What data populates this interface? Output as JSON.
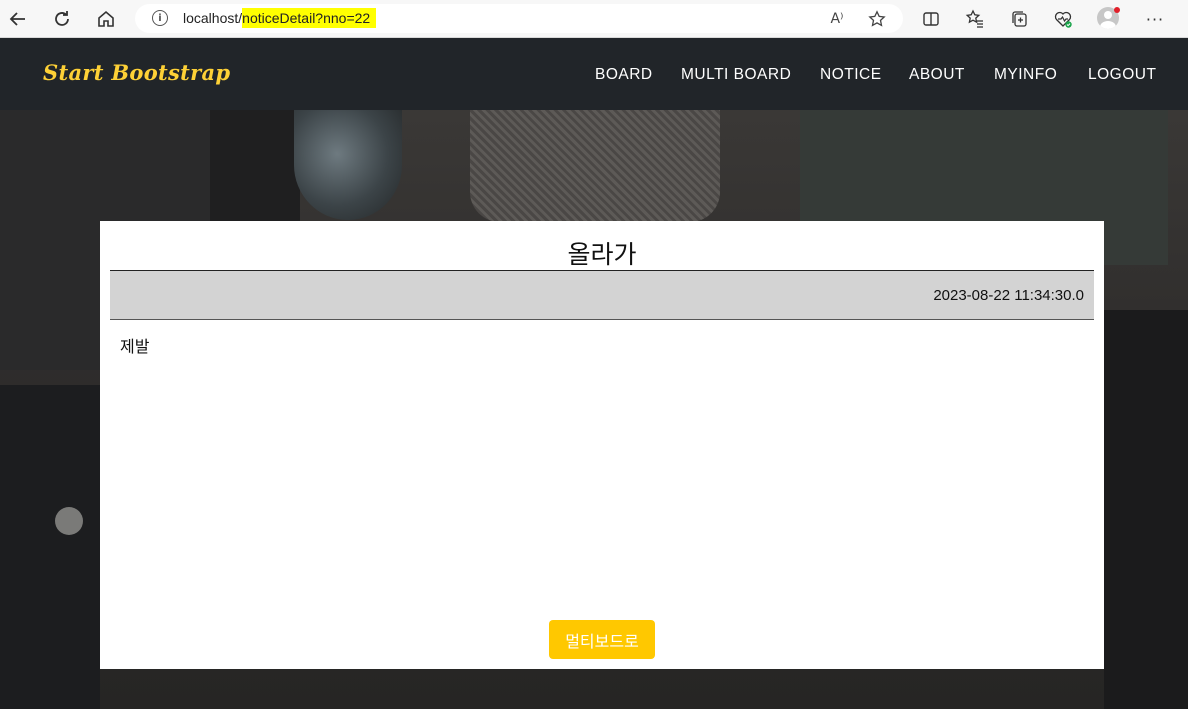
{
  "browser": {
    "url_prefix": "localhost/",
    "url_highlighted": "noticeDetail?nno=22",
    "read_aloud_label": "A⁾",
    "icons": [
      "back-icon",
      "refresh-icon",
      "home-icon",
      "info-icon",
      "read-aloud-icon",
      "favorite-star-icon",
      "split-screen-icon",
      "favorites-icon",
      "collections-icon",
      "browser-essentials-icon",
      "profile-icon",
      "more-icon"
    ],
    "highlight_color": "#ffff00"
  },
  "navbar": {
    "brand": "Start Bootstrap",
    "items": [
      {
        "label": "BOARD"
      },
      {
        "label": "MULTI BOARD"
      },
      {
        "label": "NOTICE"
      },
      {
        "label": "ABOUT"
      },
      {
        "label": "MYINFO"
      },
      {
        "label": "LOGOUT"
      }
    ],
    "brand_color": "#fed136",
    "background": "#212529"
  },
  "notice": {
    "title": "올라가",
    "date": "2023-08-22 11:34:30.0",
    "content": "제발",
    "back_button_label": "멀티보드로",
    "button_color": "#ffc800"
  }
}
